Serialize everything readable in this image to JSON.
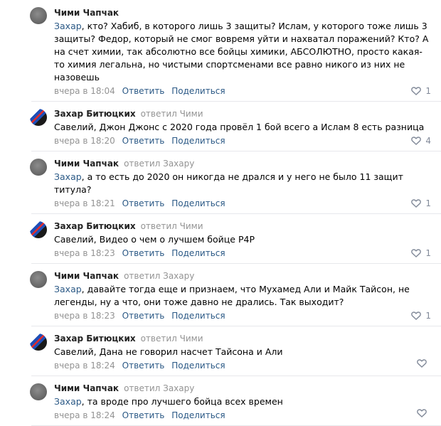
{
  "comments": [
    {
      "author": "Чими Чапчак",
      "reply_to": "",
      "avatar": "grey",
      "addressee": "Захар",
      "text": ", кто? Хабиб, в которого лишь 3 защиты? Ислам, у которого тоже лишь 3 защиты? Федор, который не смог вовремя уйти и нахватал поражений? Кто? А на счет химии, так абсолютно все бойцы химики, АБСОЛЮТНО, просто какая-то химия легальна, но чистыми спортсменами все равно никого из них не назовешь",
      "time": "вчера в 18:04",
      "reply": "Ответить",
      "share": "Поделиться",
      "likes": "1"
    },
    {
      "author": "Захар Битюцких",
      "reply_to": "ответил Чими",
      "avatar": "flag",
      "addressee": "",
      "text": "Савелий, Джон Джонс с 2020 года провёл 1 бой всего а Ислам 8 есть разница",
      "time": "вчера в 18:20",
      "reply": "Ответить",
      "share": "Поделиться",
      "likes": "4"
    },
    {
      "author": "Чими Чапчак",
      "reply_to": "ответил Захару",
      "avatar": "grey",
      "addressee": "Захар",
      "text": ", а то есть до 2020 он никогда не дрался и у него не было 11 защит титула?",
      "time": "вчера в 18:21",
      "reply": "Ответить",
      "share": "Поделиться",
      "likes": "1"
    },
    {
      "author": "Захар Битюцких",
      "reply_to": "ответил Чими",
      "avatar": "flag",
      "addressee": "",
      "text": "Савелий, Видео о чем о лучшем бойце Р4Р",
      "time": "вчера в 18:23",
      "reply": "Ответить",
      "share": "Поделиться",
      "likes": "1"
    },
    {
      "author": "Чими Чапчак",
      "reply_to": "ответил Захару",
      "avatar": "grey",
      "addressee": "Захар",
      "text": ", давайте тогда еще и признаем, что Мухамед Али и Майк Тайсон, не легенды, ну а что, они тоже давно не дрались. Так выходит?",
      "time": "вчера в 18:23",
      "reply": "Ответить",
      "share": "Поделиться",
      "likes": "1"
    },
    {
      "author": "Захар Битюцких",
      "reply_to": "ответил Чими",
      "avatar": "flag",
      "addressee": "",
      "text": "Савелий, Дана не говорил насчет Тайсона и Али",
      "time": "вчера в 18:24",
      "reply": "Ответить",
      "share": "Поделиться",
      "likes": ""
    },
    {
      "author": "Чими Чапчак",
      "reply_to": "ответил Захару",
      "avatar": "grey",
      "addressee": "Захар",
      "text": ", та вроде про лучшего бойца всех времен",
      "time": "вчера в 18:24",
      "reply": "Ответить",
      "share": "Поделиться",
      "likes": ""
    }
  ],
  "colors": {
    "link": "#2a5885",
    "meta": "#939393",
    "divider": "#e7e8ec"
  },
  "icons": {
    "like": "heart-outline-icon"
  }
}
